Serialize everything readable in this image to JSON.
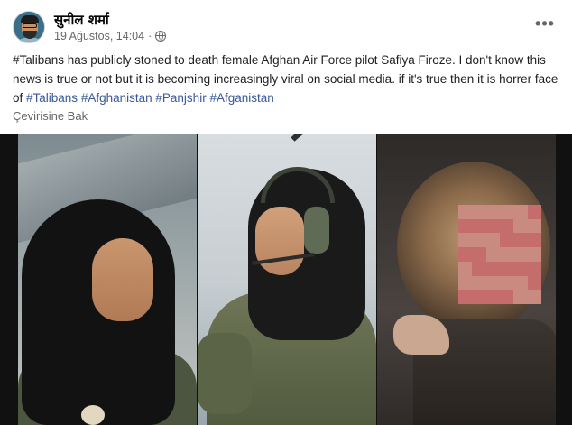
{
  "post": {
    "author": "सुनील शर्मा",
    "date": "19 Ağustos, 14:04",
    "separator": "·",
    "privacy_icon": "globe-icon",
    "more_icon": "more-options-icon",
    "more_label": "•••",
    "text_parts": [
      {
        "text": "#Talibans has publicly stoned to death female Afghan Air Force pilot Safiya Firoze. I don't know this news is true or not but it is becoming increasingly viral on social media. if it's true then it is horrer face of ",
        "tag": false
      },
      {
        "text": "#Talibans",
        "tag": true
      },
      {
        "text": " ",
        "tag": false
      },
      {
        "text": "#Afghanistan",
        "tag": true
      },
      {
        "text": " ",
        "tag": false
      },
      {
        "text": "#Panjshir",
        "tag": true
      },
      {
        "text": "  ",
        "tag": false
      },
      {
        "text": "#Afganistan",
        "tag": true
      }
    ],
    "translate_label": "Çevirisine Bak"
  },
  "colors": {
    "link": "#385898",
    "secondary_text": "#65676b",
    "primary_text": "#050505"
  }
}
